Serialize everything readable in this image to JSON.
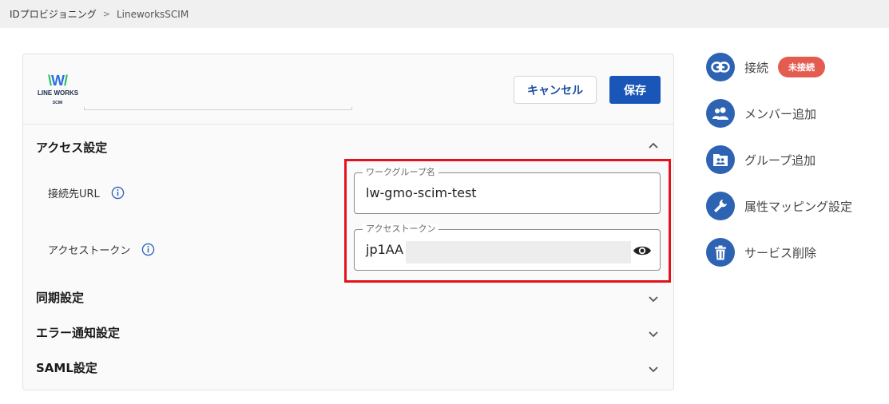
{
  "breadcrumb": {
    "root": "IDプロビジョニング",
    "separator": ">",
    "current": "LineworksSCIM"
  },
  "logo": {
    "mark": "W",
    "brand": "LINE WORKS",
    "sub": "SCIM"
  },
  "header": {
    "cancel_label": "キャンセル",
    "save_label": "保存"
  },
  "access_section": {
    "title": "アクセス設定",
    "url_label": "接続先URL",
    "token_label": "アクセストークン",
    "workgroup_field": {
      "legend": "ワークグループ名",
      "value": "lw-gmo-scim-test"
    },
    "token_field": {
      "legend": "アクセストークン",
      "value": "jp1AA"
    }
  },
  "sections": [
    {
      "title": "同期設定"
    },
    {
      "title": "エラー通知設定"
    },
    {
      "title": "SAML設定"
    }
  ],
  "side_menu": {
    "connect": {
      "label": "接続",
      "badge": "未接続",
      "icon": "link-icon"
    },
    "add_member": {
      "label": "メンバー追加",
      "icon": "people-icon"
    },
    "add_group": {
      "label": "グループ追加",
      "icon": "group-folder-icon"
    },
    "attribute_mapping": {
      "label": "属性マッピング設定",
      "icon": "wrench-icon"
    },
    "delete_service": {
      "label": "サービス削除",
      "icon": "trash-icon"
    }
  },
  "colors": {
    "primary": "#1a56b8",
    "icon_bg": "#2e63b4",
    "badge": "#e45b4f",
    "highlight": "#e4121d"
  }
}
